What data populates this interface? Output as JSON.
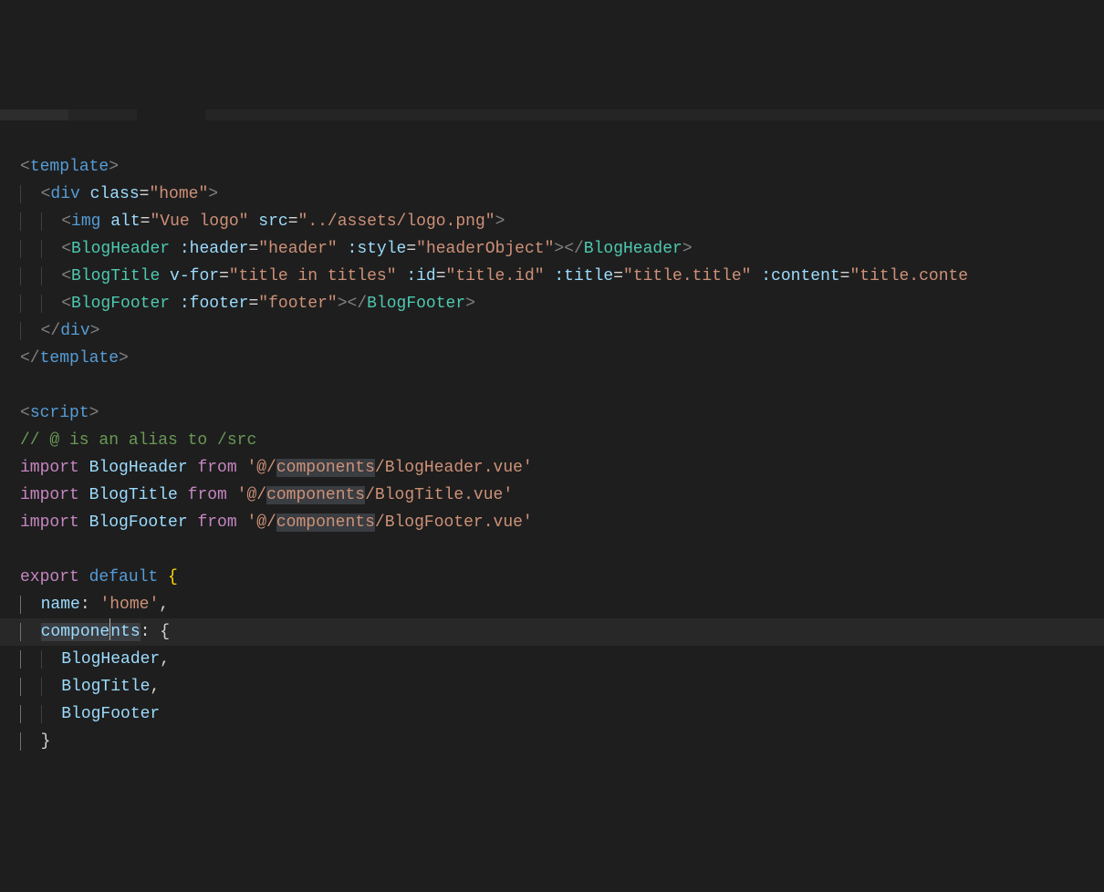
{
  "code": {
    "line1_open": "<",
    "line1_tag": "template",
    "line1_close": ">",
    "line2_open": "<",
    "line2_tag": "div",
    "line2_attr": " class",
    "line2_eq": "=",
    "line2_val": "\"home\"",
    "line2_close": ">",
    "line3_open": "<",
    "line3_tag": "img",
    "line3_attr1": " alt",
    "line3_eq1": "=",
    "line3_val1": "\"Vue logo\"",
    "line3_attr2": " src",
    "line3_eq2": "=",
    "line3_val2": "\"../assets/logo.png\"",
    "line3_close": ">",
    "line4_open": "<",
    "line4_tag": "BlogHeader",
    "line4_attr1": " :header",
    "line4_eq1": "=",
    "line4_val1": "\"header\"",
    "line4_attr2": " :style",
    "line4_eq2": "=",
    "line4_val2": "\"headerObject\"",
    "line4_mid": "></",
    "line4_tag2": "BlogHeader",
    "line4_close": ">",
    "line5_open": "<",
    "line5_tag": "BlogTitle",
    "line5_attr1": " v-for",
    "line5_eq1": "=",
    "line5_val1": "\"title in titles\"",
    "line5_attr2": " :id",
    "line5_eq2": "=",
    "line5_val2": "\"title.id\"",
    "line5_attr3": " :title",
    "line5_eq3": "=",
    "line5_val3": "\"title.title\"",
    "line5_attr4": " :content",
    "line5_eq4": "=",
    "line5_val4": "\"title.conte",
    "line6_open": "<",
    "line6_tag": "BlogFooter",
    "line6_attr1": " :footer",
    "line6_eq1": "=",
    "line6_val1": "\"footer\"",
    "line6_mid": "></",
    "line6_tag2": "BlogFooter",
    "line6_close": ">",
    "line7_open": "</",
    "line7_tag": "div",
    "line7_close": ">",
    "line8_open": "</",
    "line8_tag": "template",
    "line8_close": ">",
    "line10_open": "<",
    "line10_tag": "script",
    "line10_close": ">",
    "line11_comment": "// @ is an alias to /src",
    "line12_import": "import",
    "line12_var": " BlogHeader ",
    "line12_from": "from",
    "line12_str_pre": " '@/",
    "line12_str_hl": "components",
    "line12_str_post": "/BlogHeader.vue'",
    "line13_import": "import",
    "line13_var": " BlogTitle ",
    "line13_from": "from",
    "line13_str_pre": " '@/",
    "line13_str_hl": "components",
    "line13_str_post": "/BlogTitle.vue'",
    "line14_import": "import",
    "line14_var": " BlogFooter ",
    "line14_from": "from",
    "line14_str_pre": " '@/",
    "line14_str_hl": "components",
    "line14_str_post": "/BlogFooter.vue'",
    "line16_export": "export",
    "line16_default": " default ",
    "line16_brace": "{",
    "line17_name": "name",
    "line17_colon": ":",
    "line17_val": " 'home'",
    "line17_comma": ",",
    "line18_comp_pre": "compone",
    "line18_comp_post": "nts",
    "line18_colon": ":",
    "line18_brace": " {",
    "line19_val": "BlogHeader",
    "line19_comma": ",",
    "line20_val": "BlogTitle",
    "line20_comma": ",",
    "line21_val": "BlogFooter",
    "line22_brace": "}"
  }
}
